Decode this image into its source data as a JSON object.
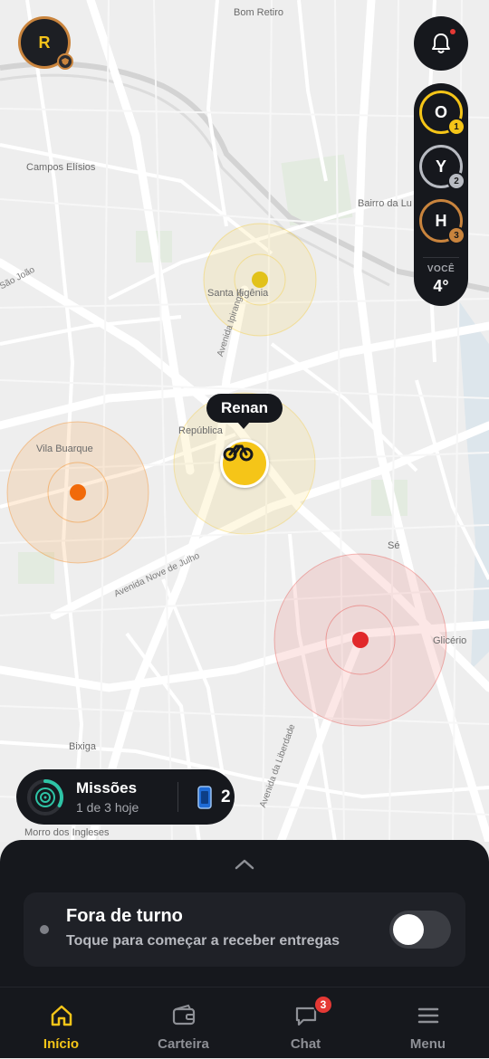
{
  "map": {
    "labels": {
      "bom_retiro": "Bom Retiro",
      "campos_eliseos": "Campos Elísios",
      "bairro_da_luz": "Bairro da Lu",
      "sao_joao": "São João",
      "santa_ifigenia": "Santa Ifigênia",
      "republica": "República",
      "vila_buarque": "Vila Buarque",
      "se": "Sé",
      "glicerio": "Glicério",
      "bixiga": "Bixiga",
      "morro_dos_ingleses": "Morro dos Ingleses",
      "avenida_ipiranga": "Avenida Ipiranga",
      "avenida_nove_de_julho": "Avenida Nove de Julho",
      "avenida_da_liberdade": "Avenida da Liberdade"
    },
    "user_tooltip": "Renan",
    "colors": {
      "yellow": "#f5c518",
      "orange": "#f57c00",
      "red": "#e53935"
    }
  },
  "profile": {
    "initial": "R",
    "ring_color": "#c9843d"
  },
  "ranking": {
    "items": [
      {
        "letter": "O",
        "position": "1",
        "ring_color": "#f5c518"
      },
      {
        "letter": "Y",
        "position": "2",
        "ring_color": "#b8bbc2"
      },
      {
        "letter": "H",
        "position": "3",
        "ring_color": "#c9843d"
      }
    ],
    "you_label": "VOCÊ",
    "you_position": "4°"
  },
  "missions": {
    "title": "Missões",
    "subtitle": "1 de 3 hoje",
    "count": "2"
  },
  "shift": {
    "title": "Fora de turno",
    "subtitle": "Toque para começar a receber entregas",
    "toggle_on": false
  },
  "nav": {
    "items": [
      {
        "label": "Início",
        "icon": "home-icon",
        "active": true
      },
      {
        "label": "Carteira",
        "icon": "wallet-icon",
        "active": false
      },
      {
        "label": "Chat",
        "icon": "chat-icon",
        "active": false,
        "badge": "3"
      },
      {
        "label": "Menu",
        "icon": "menu-icon",
        "active": false
      }
    ]
  }
}
